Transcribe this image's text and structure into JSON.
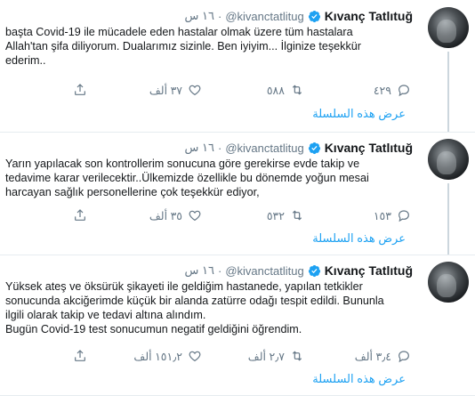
{
  "profile": {
    "name": "Kıvanç Tatlıtuğ",
    "handle": "@kivanctatlitug",
    "separator": "·"
  },
  "colors": {
    "accent": "#1da1f2",
    "muted": "#657786",
    "divider": "#e6ecf0",
    "text": "#14171a"
  },
  "icons": [
    "verified-badge-icon",
    "reply-icon",
    "retweet-icon",
    "like-icon",
    "share-icon"
  ],
  "tweets": [
    {
      "time": "١٦ س",
      "text": "başta Covid-19 ile mücadele eden hastalar olmak üzere tüm hastalara\nAllah'tan şifa diliyorum. Dualarımız sizinle. Ben iyiyim... İlginize teşekkür\nederim..",
      "replies": "٤٢٩",
      "retweets": "٥٨٨",
      "likes": "٣٧ ألف",
      "show_thread": "عرض هذه السلسلة"
    },
    {
      "time": "١٦ س",
      "text": "Yarın yapılacak son kontrollerim sonucuna göre gerekirse evde takip ve\ntedavime karar verilecektir..Ülkemizde özellikle bu dönemde yoğun mesai\nharcayan sağlık personellerine çok teşekkür ediyor,",
      "replies": "١٥٣",
      "retweets": "٥٣٢",
      "likes": "٣٥ ألف",
      "show_thread": "عرض هذه السلسلة"
    },
    {
      "time": "١٦ س",
      "text": "Yüksek ateş ve öksürük şikayeti ile geldiğim hastanede, yapılan tetkikler\nsonucunda akciğerimde küçük bir alanda zatürre odağı tespit edildi. Bununla\nilgili olarak takip ve tedavi altına alındım.\nBugün Covid-19 test sonucumun negatif geldiğini öğrendim.",
      "replies": "٣٫٤ ألف",
      "retweets": "٢٫٧ ألف",
      "likes": "١٥١٫٢ ألف",
      "show_thread": "عرض هذه السلسلة"
    }
  ]
}
